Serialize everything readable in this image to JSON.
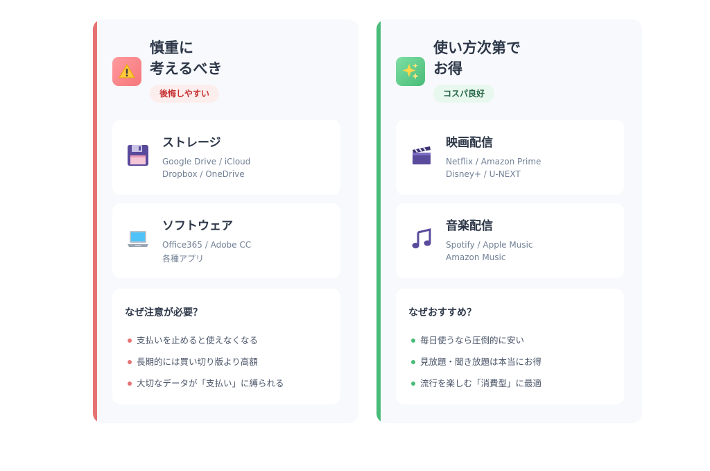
{
  "colors": {
    "left_accent": "#e57373",
    "right_accent": "#48bb78",
    "left_badge_text": "#c53030",
    "right_badge_text": "#276749"
  },
  "left": {
    "header": {
      "icon": "warning-icon",
      "title_line1": "慎重に",
      "title_line2": "考えるべき",
      "badge": "後悔しやすい"
    },
    "items": [
      {
        "icon": "floppy-disk-icon",
        "title": "ストレージ",
        "line1": "Google Drive / iCloud",
        "line2": "Dropbox / OneDrive"
      },
      {
        "icon": "laptop-icon",
        "title": "ソフトウェア",
        "line1": "Office365 / Adobe CC",
        "line2": "各種アプリ"
      }
    ],
    "why": {
      "title": "なぜ注意が必要？",
      "points": [
        "支払いを止めると使えなくなる",
        "長期的には買い切り版より高額",
        "大切なデータが「支払い」に縛られる"
      ]
    }
  },
  "right": {
    "header": {
      "icon": "sparkles-icon",
      "title_line1": "使い方次第で",
      "title_line2": "お得",
      "badge": "コスパ良好"
    },
    "items": [
      {
        "icon": "clapperboard-icon",
        "title": "映画配信",
        "line1": "Netflix / Amazon Prime",
        "line2": "Disney+ / U-NEXT"
      },
      {
        "icon": "music-note-icon",
        "title": "音楽配信",
        "line1": "Spotify / Apple Music",
        "line2": "Amazon Music"
      }
    ],
    "why": {
      "title": "なぜおすすめ？",
      "points": [
        "毎日使うなら圧倒的に安い",
        "見放題・聞き放題は本当にお得",
        "流行を楽しむ「消費型」に最適"
      ]
    }
  }
}
